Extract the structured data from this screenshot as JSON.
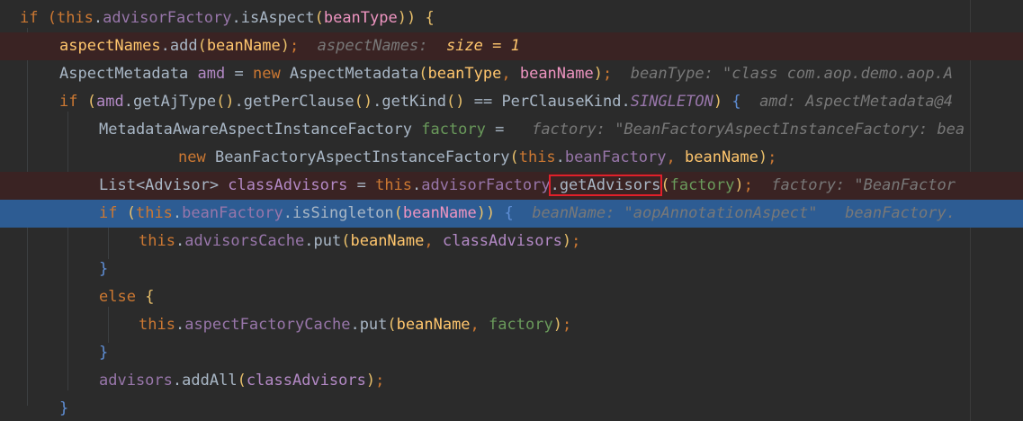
{
  "editor": {
    "lines": [
      {
        "tokens": [
          {
            "t": "if (",
            "c": "kw"
          },
          {
            "t": "this",
            "c": "kw"
          },
          {
            "t": ".",
            "c": "id"
          },
          {
            "t": "advisorFactory",
            "c": "fld"
          },
          {
            "t": ".",
            "c": "id"
          },
          {
            "t": "isAspect",
            "c": "id"
          },
          {
            "t": "(",
            "c": "bk1"
          },
          {
            "t": "beanType",
            "c": "prm"
          },
          {
            "t": ")) {",
            "c": "bk1"
          }
        ]
      },
      {
        "tokens": [
          {
            "t": "aspectNames",
            "c": "mth"
          },
          {
            "t": ".",
            "c": "id"
          },
          {
            "t": "add",
            "c": "id"
          },
          {
            "t": "(",
            "c": "bk1"
          },
          {
            "t": "beanName",
            "c": "mth"
          },
          {
            "t": ")",
            "c": "bk1"
          },
          {
            "t": ";",
            "c": "kw"
          },
          {
            "t": "  aspectNames:  ",
            "c": "hint"
          },
          {
            "t": "size = 1",
            "c": "mth it"
          }
        ]
      },
      {
        "tokens": [
          {
            "t": "AspectMetadata ",
            "c": "id"
          },
          {
            "t": "amd",
            "c": "lv"
          },
          {
            "t": " = ",
            "c": "id"
          },
          {
            "t": "new ",
            "c": "kw"
          },
          {
            "t": "AspectMetadata",
            "c": "id"
          },
          {
            "t": "(",
            "c": "bk1"
          },
          {
            "t": "beanType",
            "c": "mth"
          },
          {
            "t": ", ",
            "c": "kw"
          },
          {
            "t": "beanName",
            "c": "prm"
          },
          {
            "t": ")",
            "c": "bk1"
          },
          {
            "t": ";",
            "c": "kw"
          },
          {
            "t": "  beanType: \"class com.aop.demo.aop.A",
            "c": "hint"
          }
        ]
      },
      {
        "tokens": [
          {
            "t": "if ",
            "c": "kw"
          },
          {
            "t": "(",
            "c": "bk1"
          },
          {
            "t": "amd",
            "c": "lv"
          },
          {
            "t": ".",
            "c": "id"
          },
          {
            "t": "getAjType",
            "c": "id"
          },
          {
            "t": "()",
            "c": "bk1"
          },
          {
            "t": ".",
            "c": "id"
          },
          {
            "t": "getPerClause",
            "c": "id"
          },
          {
            "t": "()",
            "c": "bk1"
          },
          {
            "t": ".",
            "c": "id"
          },
          {
            "t": "getKind",
            "c": "id"
          },
          {
            "t": "()",
            "c": "bk1"
          },
          {
            "t": " == PerClauseKind.",
            "c": "id"
          },
          {
            "t": "SINGLETON",
            "c": "fld it"
          },
          {
            "t": ") ",
            "c": "bk1"
          },
          {
            "t": "{",
            "c": "bk2"
          },
          {
            "t": "  amd: AspectMetadata@4",
            "c": "hint"
          }
        ]
      },
      {
        "tokens": [
          {
            "t": "MetadataAwareAspectInstanceFactory ",
            "c": "id"
          },
          {
            "t": "factory",
            "c": "lvg"
          },
          {
            "t": " =  ",
            "c": "id"
          },
          {
            "t": " factory: \"BeanFactoryAspectInstanceFactory: bea",
            "c": "hint"
          }
        ]
      },
      {
        "tokens": [
          {
            "t": "new ",
            "c": "kw"
          },
          {
            "t": "BeanFactoryAspectInstanceFactory",
            "c": "id"
          },
          {
            "t": "(",
            "c": "bk1"
          },
          {
            "t": "this",
            "c": "kw"
          },
          {
            "t": ".",
            "c": "id"
          },
          {
            "t": "beanFactory",
            "c": "fld"
          },
          {
            "t": ", ",
            "c": "kw"
          },
          {
            "t": "beanName",
            "c": "mth"
          },
          {
            "t": ")",
            "c": "bk1"
          },
          {
            "t": ";",
            "c": "kw"
          }
        ]
      },
      {
        "tokens": [
          {
            "t": "List<Advisor> ",
            "c": "id"
          },
          {
            "t": "classAdvisors",
            "c": "lv"
          },
          {
            "t": " = ",
            "c": "id"
          },
          {
            "t": "this",
            "c": "kw"
          },
          {
            "t": ".",
            "c": "id"
          },
          {
            "t": "advisorFactory",
            "c": "fld"
          },
          {
            "t": ".getAdvisors",
            "c": "id box"
          },
          {
            "t": "(",
            "c": "bk1"
          },
          {
            "t": "factory",
            "c": "lvg"
          },
          {
            "t": ")",
            "c": "bk1"
          },
          {
            "t": ";",
            "c": "kw"
          },
          {
            "t": "  factory: \"BeanFactor",
            "c": "hint"
          }
        ]
      },
      {
        "tokens": [
          {
            "t": "if ",
            "c": "kw"
          },
          {
            "t": "(",
            "c": "bk1"
          },
          {
            "t": "this",
            "c": "kw"
          },
          {
            "t": ".",
            "c": "id"
          },
          {
            "t": "beanFactory",
            "c": "fld"
          },
          {
            "t": ".",
            "c": "id"
          },
          {
            "t": "isSingleton",
            "c": "id"
          },
          {
            "t": "(",
            "c": "bk1"
          },
          {
            "t": "beanName",
            "c": "prm"
          },
          {
            "t": ")) ",
            "c": "bk1"
          },
          {
            "t": "{",
            "c": "bk2"
          },
          {
            "t": "  beanName: \"aopAnnotationAspect\"   beanFactory.",
            "c": "hint"
          }
        ]
      },
      {
        "tokens": [
          {
            "t": "this",
            "c": "kw"
          },
          {
            "t": ".",
            "c": "id"
          },
          {
            "t": "advisorsCache",
            "c": "fld"
          },
          {
            "t": ".",
            "c": "id"
          },
          {
            "t": "put",
            "c": "id"
          },
          {
            "t": "(",
            "c": "bk1"
          },
          {
            "t": "beanName",
            "c": "mth"
          },
          {
            "t": ", ",
            "c": "kw"
          },
          {
            "t": "classAdvisors",
            "c": "lv"
          },
          {
            "t": ")",
            "c": "bk1"
          },
          {
            "t": ";",
            "c": "kw"
          }
        ]
      },
      {
        "tokens": [
          {
            "t": "}",
            "c": "bk2"
          }
        ]
      },
      {
        "tokens": [
          {
            "t": "else ",
            "c": "kw"
          },
          {
            "t": "{",
            "c": "bk1"
          }
        ]
      },
      {
        "tokens": [
          {
            "t": "this",
            "c": "kw"
          },
          {
            "t": ".",
            "c": "id"
          },
          {
            "t": "aspectFactoryCache",
            "c": "fld"
          },
          {
            "t": ".",
            "c": "id"
          },
          {
            "t": "put",
            "c": "id"
          },
          {
            "t": "(",
            "c": "bk1"
          },
          {
            "t": "beanName",
            "c": "mth"
          },
          {
            "t": ", ",
            "c": "kw"
          },
          {
            "t": "factory",
            "c": "lvg"
          },
          {
            "t": ")",
            "c": "bk1"
          },
          {
            "t": ";",
            "c": "kw"
          }
        ]
      },
      {
        "tokens": [
          {
            "t": "}",
            "c": "bk2"
          }
        ]
      },
      {
        "tokens": [
          {
            "t": "advisors",
            "c": "fld"
          },
          {
            "t": ".",
            "c": "id"
          },
          {
            "t": "addAll",
            "c": "id"
          },
          {
            "t": "(",
            "c": "bk1"
          },
          {
            "t": "classAdvisors",
            "c": "lv"
          },
          {
            "t": ")",
            "c": "bk1"
          },
          {
            "t": ";",
            "c": "kw"
          }
        ]
      },
      {
        "tokens": [
          {
            "t": "}",
            "c": "bk2"
          }
        ]
      }
    ]
  }
}
